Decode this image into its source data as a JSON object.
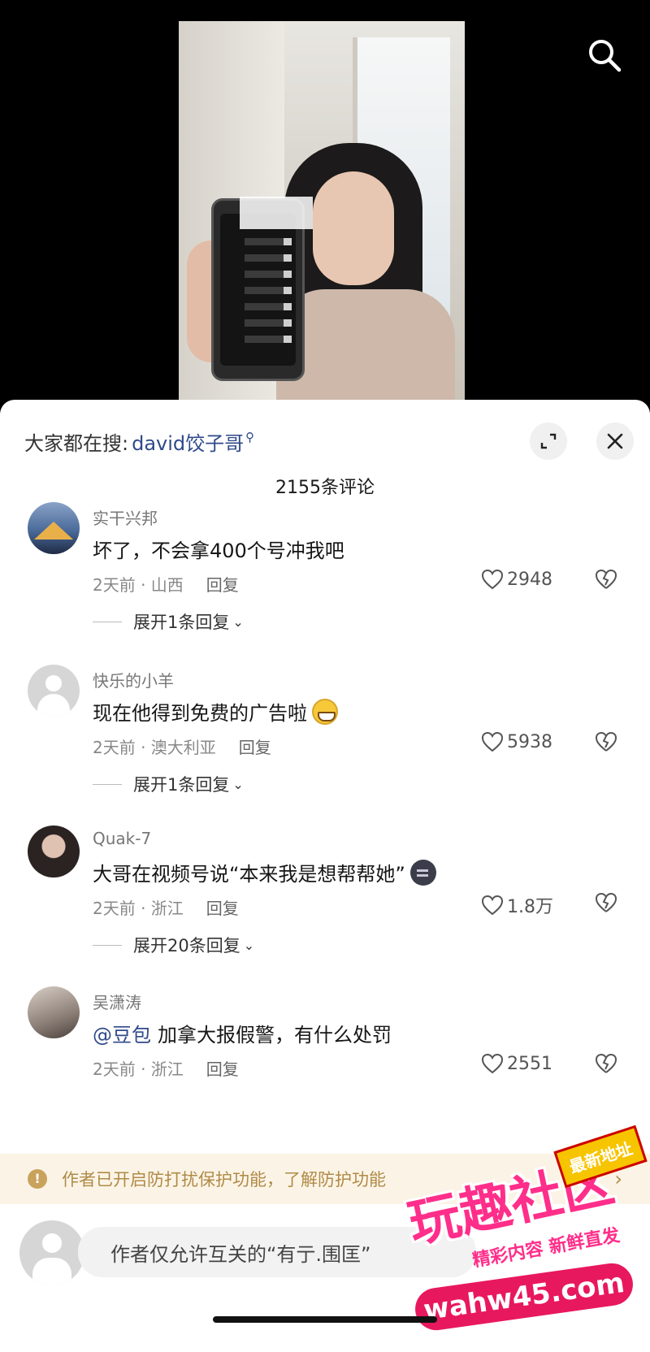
{
  "hot_search": {
    "prefix": "大家都在搜:",
    "keyword": "david饺子哥"
  },
  "comment_count": "2155条评论",
  "comments": [
    {
      "user": "实干兴邦",
      "text": "坏了，不会拿400个号冲我吧",
      "time": "2天前 · 山西",
      "reply": "回复",
      "likes": "2948",
      "expand": "展开1条回复",
      "avatar_icon": "mountain-avatar"
    },
    {
      "user": "快乐的小羊",
      "text": "现在他得到免费的广告啦",
      "emoji": "grin-emoji",
      "time": "2天前 · 澳大利亚",
      "reply": "回复",
      "likes": "5938",
      "expand": "展开1条回复",
      "avatar_icon": "default-avatar"
    },
    {
      "user": "Quak-7",
      "text": "大哥在视频号说“本来我是想帮帮她”",
      "emoji": "dark-emoji",
      "time": "2天前 · 浙江",
      "reply": "回复",
      "likes": "1.8万",
      "expand": "展开20条回复",
      "avatar_icon": "photo-avatar"
    },
    {
      "user": "吴潇涛",
      "mention": "@豆包",
      "text": "加拿大报假警，有什么处罚",
      "time": "2天前 · 浙江",
      "reply": "回复",
      "likes": "2551",
      "avatar_icon": "photo-avatar"
    }
  ],
  "notice": {
    "text": "作者已开启防打扰保护功能，了解防护功能",
    "warn_symbol": "!",
    "arrow": "›"
  },
  "composer": {
    "placeholder": "作者仅允许互关的“有亍.围匡”"
  },
  "watermark": {
    "main": "玩趣社区",
    "badge": "最新地址",
    "sub": "精彩内容 新鲜直发",
    "url": "wahw45.com"
  },
  "colors": {
    "accent_link": "#2f4a8a",
    "notice_bg": "#fbf4e6",
    "notice_text": "#b08a47"
  }
}
